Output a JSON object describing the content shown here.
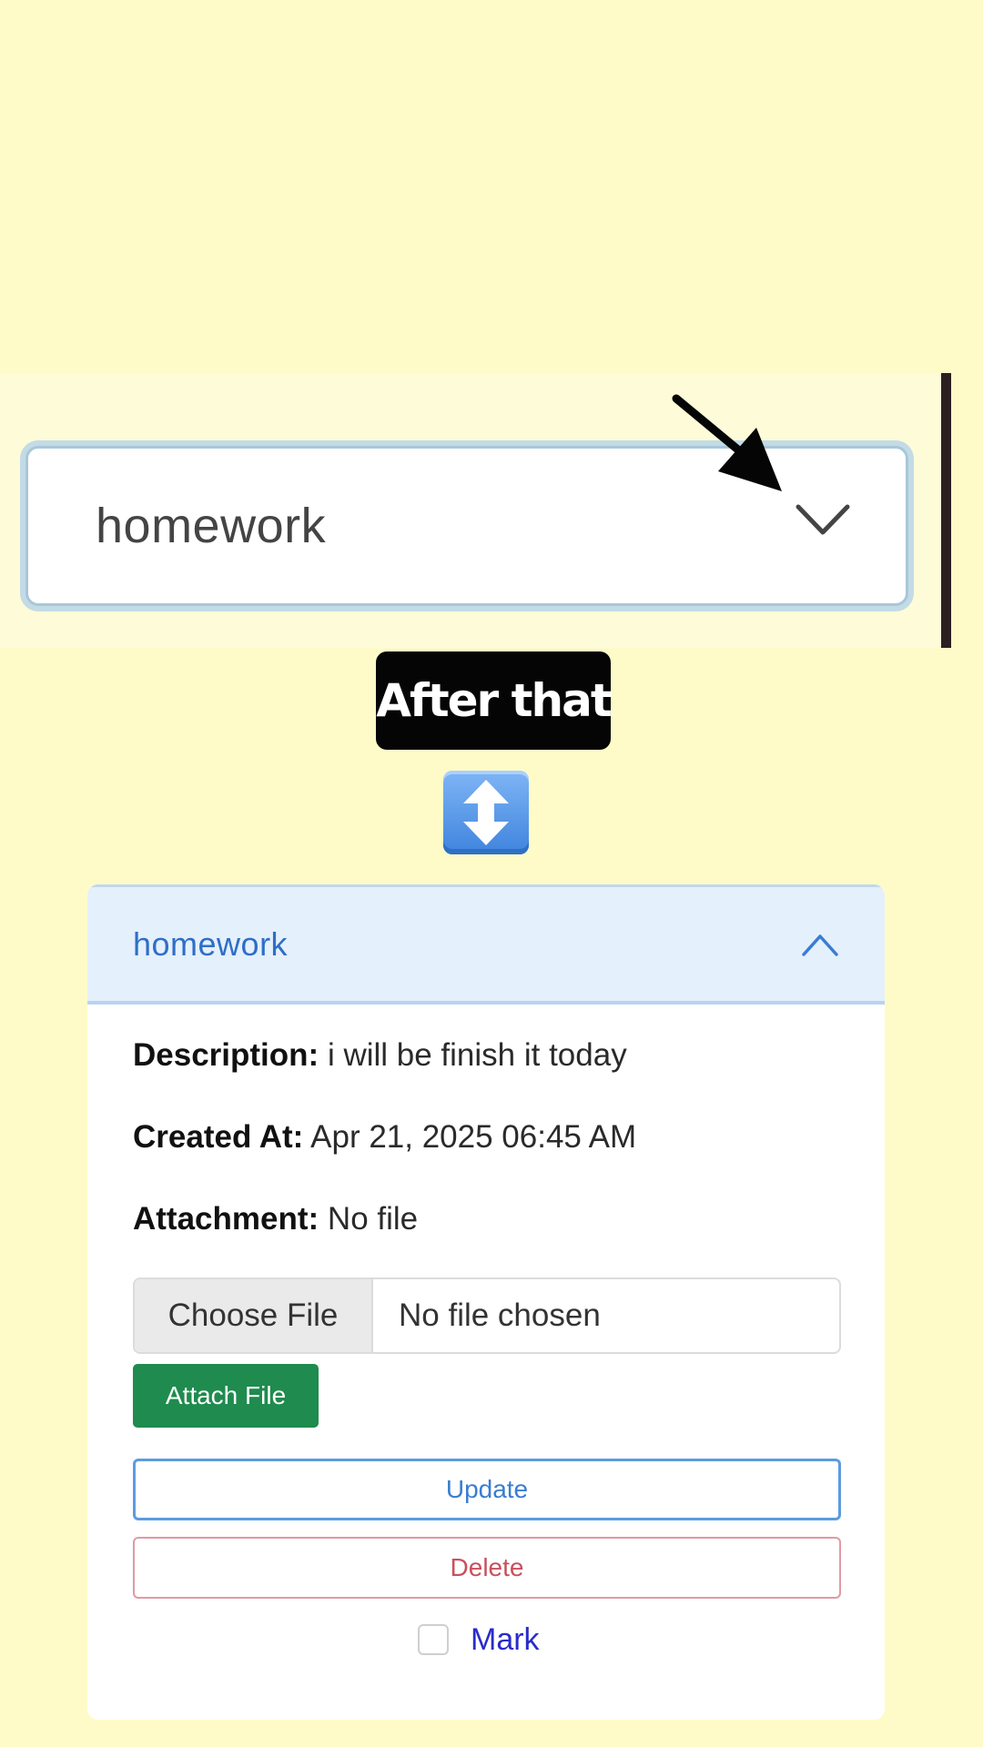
{
  "dropdown": {
    "value": "homework"
  },
  "annotation": {
    "label": "After that",
    "emoji": "up-down-arrow-emoji"
  },
  "accordion": {
    "title": "homework",
    "description_label": "Description:",
    "description_value": "i will be finish it today",
    "created_label": "Created At:",
    "created_value": "Apr 21, 2025 06:45 AM",
    "attachment_label": "Attachment:",
    "attachment_value": "No file",
    "file_input": {
      "button_label": "Choose File",
      "status": "No file chosen"
    },
    "attach_button": "Attach File",
    "update_button": "Update",
    "delete_button": "Delete",
    "mark_label": "Mark"
  },
  "colors": {
    "background": "#fefbc9",
    "header_bg": "#e5f0fd",
    "attach_green": "#1f8b4e",
    "update_blue": "#3a7dd0",
    "delete_red": "#c9505c",
    "mark_blue": "#2a2bc9"
  },
  "icons": {
    "dropdown_chevron": "chevron-down-icon",
    "header_chevron": "chevron-up-icon",
    "pointer": "pointer-arrow-icon"
  }
}
